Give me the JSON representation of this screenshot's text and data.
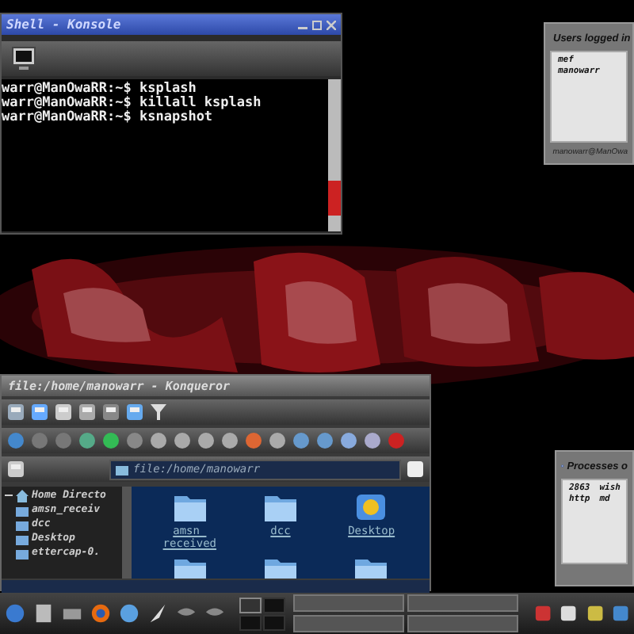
{
  "konsole": {
    "title": "Shell - Konsole",
    "lines": [
      "warr@ManOwaRR:~$ ksplash",
      "warr@ManOwaRR:~$ killall ksplash",
      "warr@ManOwaRR:~$ ksnapshot"
    ]
  },
  "users_widget": {
    "title": "Users logged in",
    "items": [
      "mef",
      "manowarr"
    ],
    "footer": "manowarr@ManOwa"
  },
  "konqueror": {
    "title": "file:/home/manowarr - Konqueror",
    "location": "file:/home/manowarr",
    "tree": [
      {
        "label": "Home Directo",
        "expanded": true,
        "children": [
          {
            "label": "amsn_receiv"
          },
          {
            "label": "dcc"
          },
          {
            "label": "Desktop"
          },
          {
            "label": "ettercap-0."
          }
        ]
      }
    ],
    "files": [
      {
        "name": "amsn_\nreceived",
        "kind": "folder"
      },
      {
        "name": "dcc",
        "kind": "folder"
      },
      {
        "name": "Desktop",
        "kind": "desktop"
      },
      {
        "kind": "folder"
      },
      {
        "kind": "folder"
      },
      {
        "kind": "folder"
      }
    ]
  },
  "processes_widget": {
    "title": "Processes o",
    "rows": [
      [
        "2863",
        "wish"
      ],
      [
        "http",
        "md"
      ]
    ]
  },
  "taskbar": {
    "pager": [
      {
        "selected": true
      },
      {
        "selected": false
      },
      {
        "selected": false
      },
      {
        "selected": false
      }
    ]
  }
}
